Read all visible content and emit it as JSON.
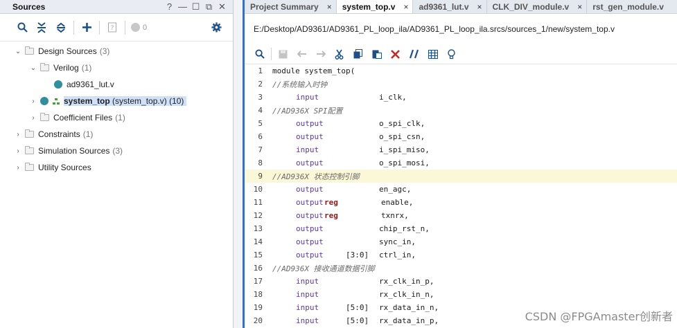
{
  "sources": {
    "title": "Sources",
    "window_buttons": [
      "?",
      "—",
      "☐",
      "⧉",
      "✕"
    ],
    "toolbar": {
      "icons": [
        "search-icon",
        "collapse-all-icon",
        "expand-all-icon",
        "add-icon",
        "unknown-file-icon"
      ],
      "count": "0",
      "settings_icon": "gear-icon"
    },
    "tree": {
      "design_sources": {
        "label": "Design Sources",
        "count": "(3)"
      },
      "verilog": {
        "label": "Verilog",
        "count": "(1)"
      },
      "ad9361_lut": {
        "label": "ad9361_lut.v"
      },
      "system_top": {
        "label": "system_top",
        "detail": "(system_top.v) (10)"
      },
      "coefficient_files": {
        "label": "Coefficient Files",
        "count": "(1)"
      },
      "constraints": {
        "label": "Constraints",
        "count": "(1)"
      },
      "simulation_sources": {
        "label": "Simulation Sources",
        "count": "(3)"
      },
      "utility_sources": {
        "label": "Utility Sources"
      }
    }
  },
  "editor": {
    "tabs": [
      {
        "label": "Project Summary",
        "close": "×"
      },
      {
        "label": "system_top.v",
        "close": "×"
      },
      {
        "label": "ad9361_lut.v",
        "close": "×"
      },
      {
        "label": "CLK_DIV_module.v",
        "close": "×"
      },
      {
        "label": "rst_gen_module.v"
      }
    ],
    "filepath": "E:/Desktop/AD9361/AD9361_PL_loop_ila/AD9361_PL_loop_ila.srcs/sources_1/new/system_top.v",
    "code": {
      "l1": {
        "n": "1",
        "t": "module system_top("
      },
      "l2": {
        "n": "2",
        "t": "//系统输入时钟"
      },
      "l3": {
        "n": "3",
        "kw": "input",
        "name": "i_clk,"
      },
      "l4": {
        "n": "4",
        "t": "//AD936X SPI配置"
      },
      "l5": {
        "n": "5",
        "kw": "output",
        "name": "o_spi_clk,"
      },
      "l6": {
        "n": "6",
        "kw": "output",
        "name": "o_spi_csn,"
      },
      "l7": {
        "n": "7",
        "kw": "input",
        "name": "i_spi_miso,"
      },
      "l8": {
        "n": "8",
        "kw": "output",
        "name": "o_spi_mosi,"
      },
      "l9": {
        "n": "9",
        "t": "//AD936X 状态控制引脚"
      },
      "l10": {
        "n": "10",
        "kw": "output",
        "name": "en_agc,"
      },
      "l11": {
        "n": "11",
        "kw": "output",
        "reg": "reg",
        "name": "enable,"
      },
      "l12": {
        "n": "12",
        "kw": "output",
        "reg": "reg",
        "name": "txnrx,"
      },
      "l13": {
        "n": "13",
        "kw": "output",
        "name": "chip_rst_n,"
      },
      "l14": {
        "n": "14",
        "kw": "output",
        "name": "sync_in,"
      },
      "l15": {
        "n": "15",
        "kw": "output",
        "range": "[3:0]",
        "name": "ctrl_in,"
      },
      "l16": {
        "n": "16",
        "t": "//AD936X 接收通道数据引脚"
      },
      "l17": {
        "n": "17",
        "kw": "input",
        "name": "rx_clk_in_p,"
      },
      "l18": {
        "n": "18",
        "kw": "input",
        "name": "rx_clk_in_n,"
      },
      "l19": {
        "n": "19",
        "kw": "input",
        "range": "[5:0]",
        "name": "rx_data_in_n,"
      },
      "l20": {
        "n": "20",
        "kw": "input",
        "range": "[5:0]",
        "name": "rx_data_in_p,"
      }
    }
  },
  "watermark": "CSDN @FPGAmaster创新者"
}
